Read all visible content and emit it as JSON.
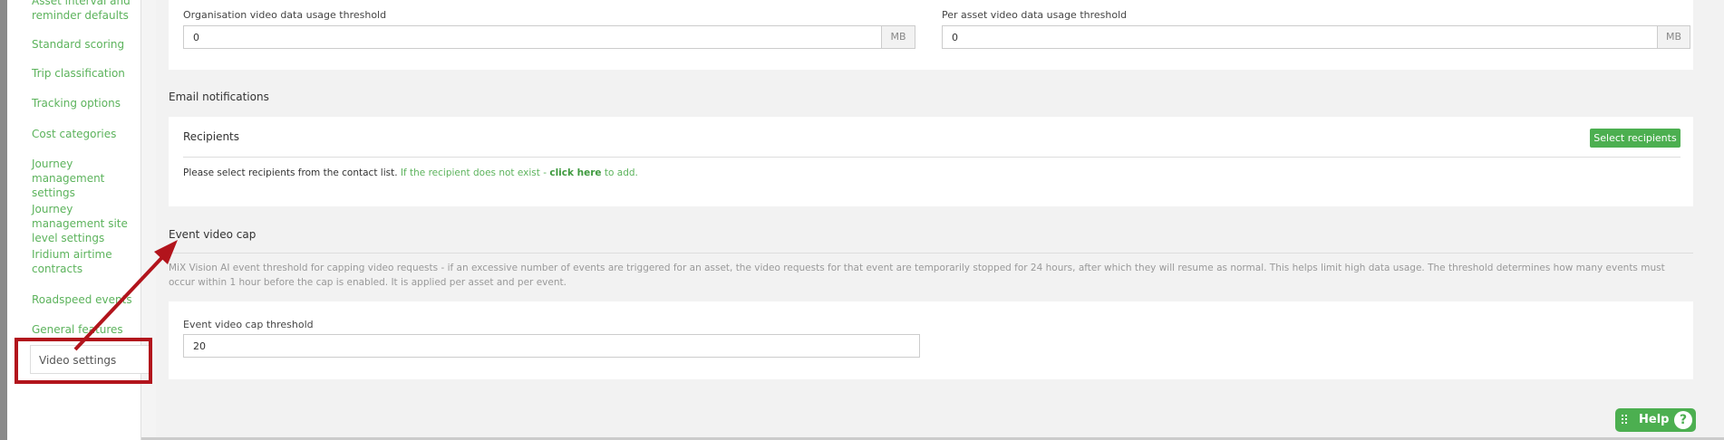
{
  "sidebar": {
    "items": [
      {
        "label": "Asset interval and reminder defaults"
      },
      {
        "label": "Standard scoring"
      },
      {
        "label": "Trip classification"
      },
      {
        "label": "Tracking options"
      },
      {
        "label": "Cost categories"
      },
      {
        "label": "Journey management settings"
      },
      {
        "label": "Journey management site level settings"
      },
      {
        "label": "Iridium airtime contracts"
      },
      {
        "label": "Roadspeed events"
      },
      {
        "label": "General features"
      },
      {
        "label": "Video settings"
      }
    ]
  },
  "usage": {
    "org_label": "Organisation video data usage threshold",
    "org_value": "0",
    "org_unit": "MB",
    "asset_label": "Per asset video data usage threshold",
    "asset_value": "0",
    "asset_unit": "MB"
  },
  "email": {
    "title": "Email notifications",
    "recipients_title": "Recipients",
    "select_button": "Select recipients",
    "info_prefix": "Please select recipients from the contact list.",
    "info_green": "If the recipient does not exist -",
    "info_link": "click here",
    "info_suffix": "to add."
  },
  "cap": {
    "title": "Event video cap",
    "description": "MiX Vision AI event threshold for capping video requests - if an excessive number of events are triggered for an asset, the video requests for that event are temporarily stopped for 24 hours, after which they will resume as normal. This helps limit high data usage. The threshold determines how many events must occur within 1 hour before the cap is enabled. It is applied per asset and per event.",
    "threshold_label": "Event video cap threshold",
    "threshold_value": "20"
  },
  "help": {
    "label": "Help",
    "icon": "question-icon"
  },
  "colors": {
    "accent": "#4caf50",
    "link": "#5cb35c",
    "annotation": "#b2141c"
  }
}
